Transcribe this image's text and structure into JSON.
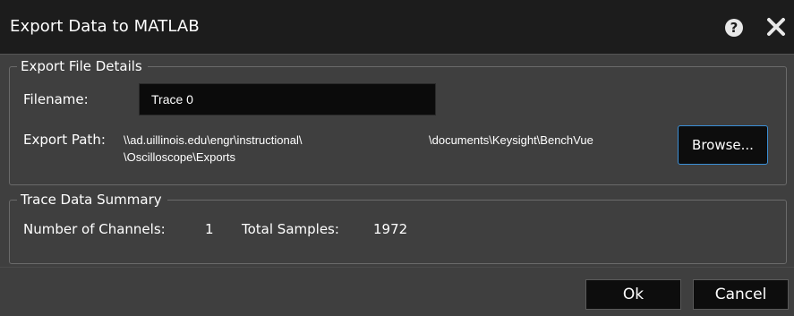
{
  "dialog": {
    "title": "Export Data to MATLAB",
    "help_icon": "help-icon",
    "close_icon": "close-icon"
  },
  "export_details": {
    "legend": "Export File Details",
    "filename_label": "Filename:",
    "filename_value": "Trace 0",
    "path_label": "Export Path:",
    "path_part1": "\\\\ad.uillinois.edu\\engr\\instructional\\",
    "path_part2": "\\documents\\Keysight\\BenchVue",
    "path_part3": "\\Oscilloscope\\Exports",
    "browse_label": "Browse..."
  },
  "trace_summary": {
    "legend": "Trace Data Summary",
    "channels_label": "Number of Channels:",
    "channels_value": "1",
    "samples_label": "Total Samples:",
    "samples_value": "1972"
  },
  "footer": {
    "ok_label": "Ok",
    "cancel_label": "Cancel"
  },
  "colors": {
    "background": "#3f3f3f",
    "titlebar": "#1c1c1c",
    "button_bg": "#0d0d0d",
    "focus_border": "#3b8fd6"
  }
}
